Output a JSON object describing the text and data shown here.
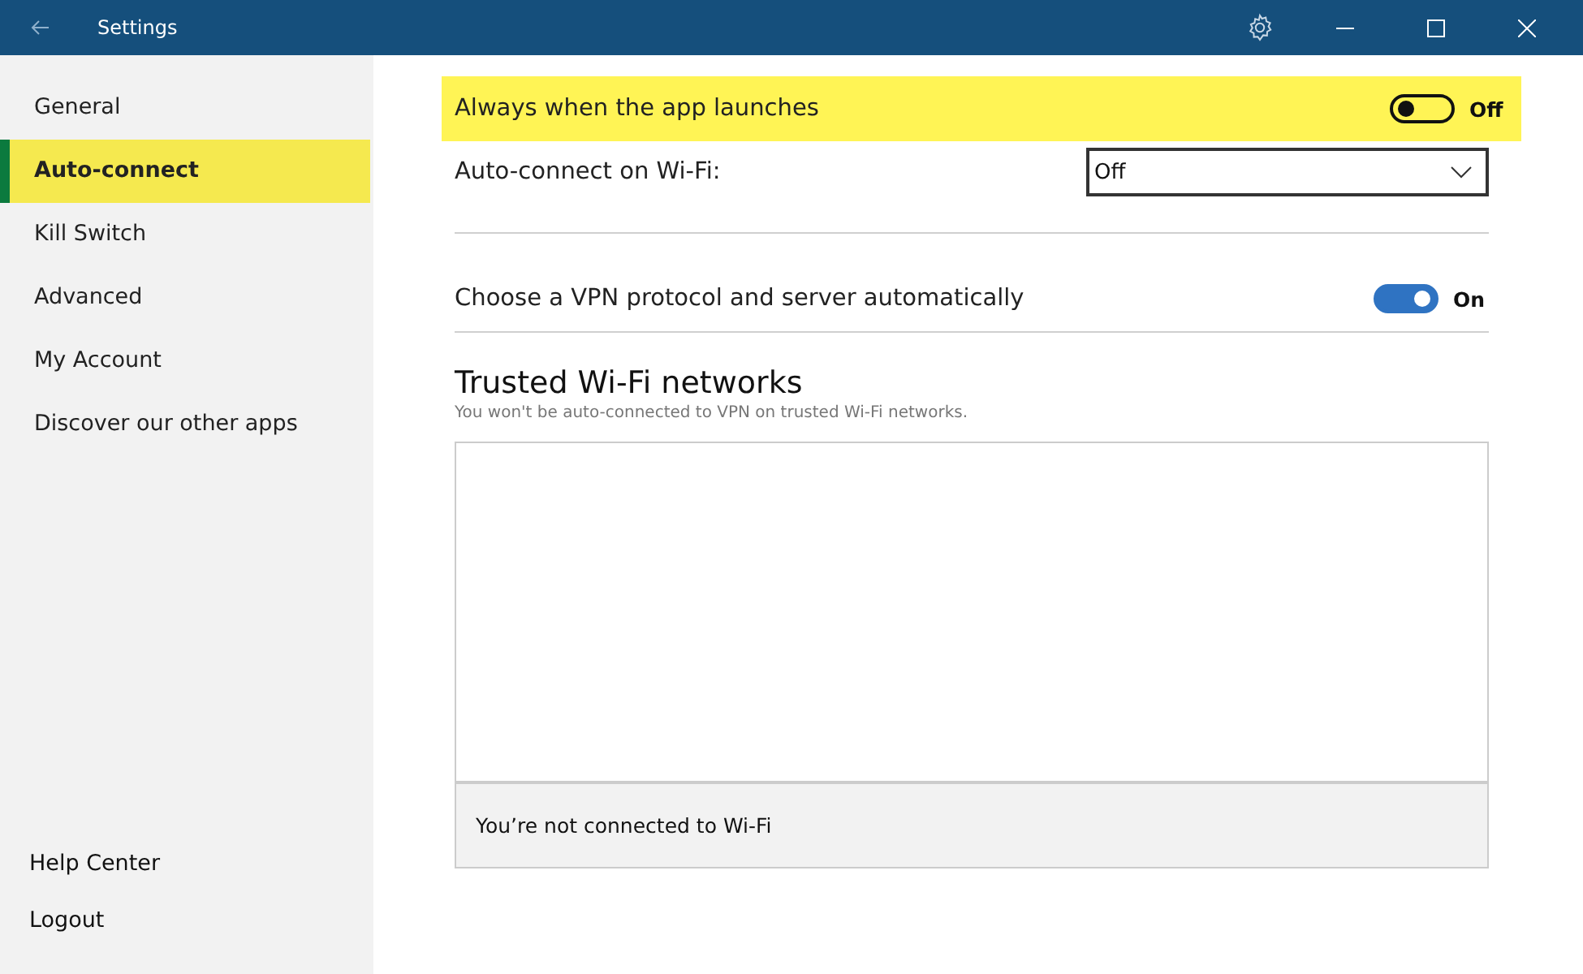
{
  "window": {
    "title": "Settings"
  },
  "sidebar": {
    "items": [
      {
        "label": "General",
        "selected": false
      },
      {
        "label": "Auto-connect",
        "selected": true
      },
      {
        "label": "Kill Switch",
        "selected": false
      },
      {
        "label": "Advanced",
        "selected": false
      },
      {
        "label": "My Account",
        "selected": false
      },
      {
        "label": "Discover our other apps",
        "selected": false
      }
    ],
    "footer_items": [
      "Help Center",
      "Logout"
    ]
  },
  "settings": [
    {
      "kind": "toggle",
      "label": "Always when the app launches",
      "on": false,
      "state_text": "Off",
      "highlighted": true
    },
    {
      "kind": "dropdown",
      "label": "Auto-connect on Wi-Fi:",
      "value": "Off",
      "highlighted": false
    },
    {
      "kind": "toggle",
      "label": "Choose a VPN protocol and server automatically",
      "on": true,
      "state_text": "On",
      "highlighted": false
    }
  ],
  "trusted_networks": {
    "title": "Trusted Wi-Fi networks",
    "subtitle": "You won't be auto-connected to VPN on trusted Wi-Fi networks.",
    "status": "You’re not connected to Wi-Fi"
  }
}
